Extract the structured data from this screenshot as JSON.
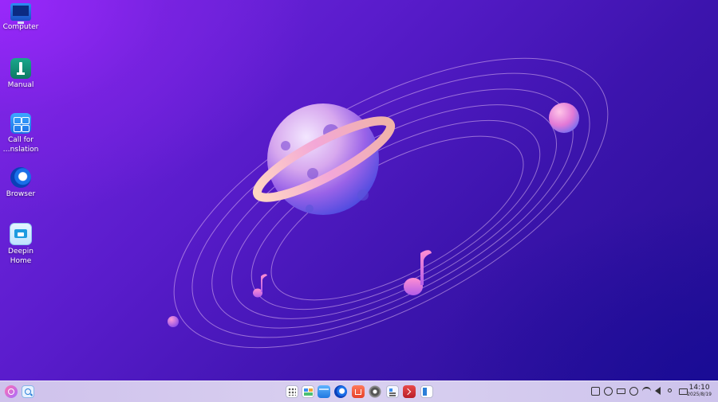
{
  "desktop": {
    "icons": [
      {
        "label": "Computer",
        "icon": "computer-icon"
      },
      {
        "label": "Manual",
        "icon": "manual-icon"
      },
      {
        "label_line1": "Call for",
        "label_line2": "…nslation",
        "icon": "translation-icon"
      },
      {
        "label": "Browser",
        "icon": "browser-icon"
      },
      {
        "label_line1": "Deepin",
        "label_line2": "Home",
        "icon": "deepin-home-icon"
      }
    ]
  },
  "taskbar": {
    "left": [
      {
        "icon": "launcher-icon"
      },
      {
        "icon": "search-icon"
      }
    ],
    "apps": [
      {
        "icon": "app-grid-icon"
      },
      {
        "icon": "multitask-view-icon"
      },
      {
        "icon": "file-manager-icon"
      },
      {
        "icon": "browser-icon"
      },
      {
        "icon": "app-store-icon"
      },
      {
        "icon": "settings-icon"
      },
      {
        "icon": "text-editor-icon"
      },
      {
        "icon": "terminal-icon"
      },
      {
        "icon": "panel-icon"
      }
    ],
    "tray": [
      {
        "icon": "keyboard-icon"
      },
      {
        "icon": "clipboard-icon"
      },
      {
        "icon": "battery-icon"
      },
      {
        "icon": "sync-icon"
      },
      {
        "icon": "wifi-icon"
      },
      {
        "icon": "volume-icon"
      },
      {
        "icon": "key-icon"
      },
      {
        "icon": "notification-icon"
      }
    ],
    "clock": {
      "time": "14:10",
      "date": "2025/8/19"
    }
  },
  "colors": {
    "wallpaper_top": "#7a28e6",
    "wallpaper_bottom": "#240f92",
    "taskbar": "#d6cdef"
  }
}
